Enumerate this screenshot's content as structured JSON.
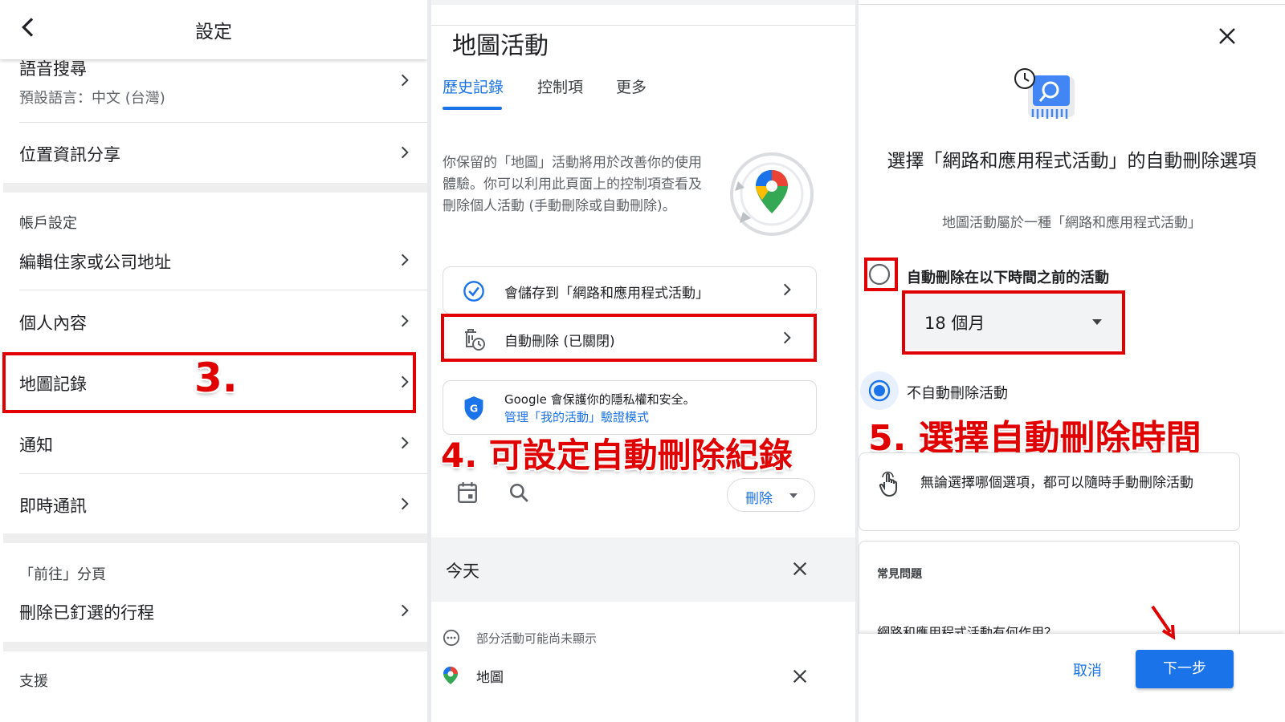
{
  "settings": {
    "title": "設定",
    "voice_search": {
      "label": "語音搜尋",
      "sub": "預設語言：中文 (台灣)"
    },
    "location_sharing": "位置資訊分享",
    "account_section": "帳戶設定",
    "edit_home_work": "編輯住家或公司地址",
    "personal_content": "個人內容",
    "maps_history": "地圖記錄",
    "notifications": "通知",
    "messaging": "即時通訊",
    "goto_section": "「前往」分頁",
    "delete_pinned": "刪除已釘選的行程",
    "support_section": "支援"
  },
  "maps_activity": {
    "title": "地圖活動",
    "tabs": [
      "歷史記錄",
      "控制項",
      "更多"
    ],
    "description": "你保留的「地圖」活動將用於改善你的使用體驗。你可以利用此頁面上的控制項查看及刪除個人活動 (手動刪除或自動刪除)。",
    "saving_card": "會儲存到「網路和應用程式活動」",
    "auto_delete_card": "自動刪除 (已關閉)",
    "privacy_line1": "Google 會保護你的隱私權和安全。",
    "privacy_link": "管理「我的活動」驗證模式",
    "delete_button": "刪除",
    "today": "今天",
    "notice": "部分活動可能尚未顯示",
    "maps_item": "地圖"
  },
  "auto_delete_dialog": {
    "title": "選擇「網路和應用程式活動」的自動刪除選項",
    "subtitle": "地圖活動屬於一種「網路和應用程式活動」",
    "option_auto": "自動刪除在以下時間之前的活動",
    "dropdown_value": "18 個月",
    "option_none": "不自動刪除活動",
    "manual_note": "無論選擇哪個選項，都可以隨時手動刪除活動",
    "faq_title": "常見問題",
    "faq_question": "網路和應用程式活動有何作用？",
    "cancel": "取消",
    "next": "下一步"
  },
  "annotations": {
    "step3": "3.",
    "step4": "4. 可設定自動刪除紀錄",
    "step5": "5. 選擇自動刪除時間"
  },
  "colors": {
    "accent": "#1a73e8",
    "annotation_red": "#e00000"
  }
}
